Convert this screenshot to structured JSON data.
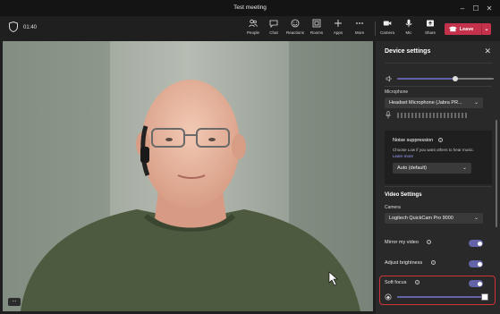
{
  "window": {
    "title": "Test meeting"
  },
  "toolbar": {
    "timer": "01:40",
    "items": [
      {
        "label": "People",
        "icon": "people-icon"
      },
      {
        "label": "Chat",
        "icon": "chat-icon"
      },
      {
        "label": "Reactions",
        "icon": "reactions-icon"
      },
      {
        "label": "Rooms",
        "icon": "rooms-icon"
      },
      {
        "label": "Apps",
        "icon": "apps-icon"
      },
      {
        "label": "More",
        "icon": "more-icon"
      },
      {
        "label": "Camera",
        "icon": "camera-icon"
      },
      {
        "label": "Mic",
        "icon": "mic-icon"
      },
      {
        "label": "Share",
        "icon": "share-icon"
      }
    ],
    "leave_label": "Leave"
  },
  "video": {
    "more_label": "..."
  },
  "panel": {
    "title": "Device settings",
    "speaker_volume": 0.6,
    "microphone_label": "Microphone",
    "microphone_value": "Headset Microphone (Jabra PR...",
    "noise_suppression": {
      "title": "Noise suppression",
      "description": "Choose Low if you want others to hear music.",
      "link": "Learn more",
      "value": "Auto (default)"
    },
    "video_settings_title": "Video Settings",
    "camera_label": "Camera",
    "camera_value": "Logitech QuickCam Pro 9000",
    "mirror_label": "Mirror my video",
    "mirror_on": true,
    "brightness_label": "Adjust brightness",
    "brightness_on": true,
    "soft_focus_label": "Soft focus",
    "soft_focus_on": true,
    "soft_focus_level": 1.0
  },
  "colors": {
    "accent": "#6264a7",
    "leave": "#c4314b",
    "highlight": "#d13438"
  }
}
